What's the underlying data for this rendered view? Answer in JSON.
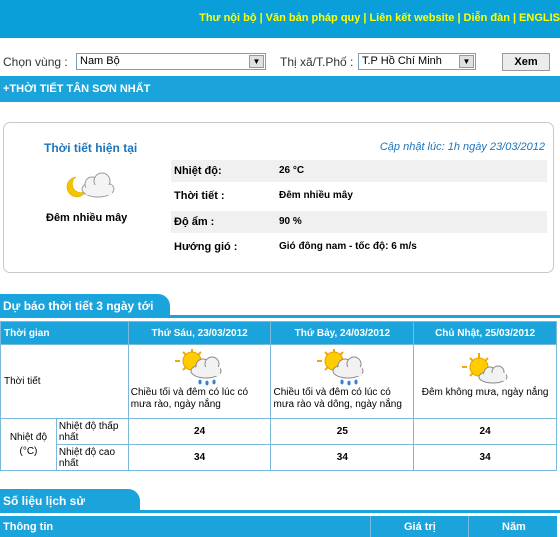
{
  "topnav": {
    "links": [
      "Thư nội bộ",
      "Văn bản pháp quy",
      "Liên kết website",
      "Diễn đàn",
      "ENGLIS"
    ]
  },
  "selector": {
    "region_label": "Chọn vùng :",
    "region_value": "Nam Bộ",
    "city_label": "Thị xã/T.Phố :",
    "city_value": "T.P Hồ Chí Minh",
    "submit_label": "Xem"
  },
  "station_bar": "+THỜI TIẾT  TÂN SƠN NHẤT",
  "current": {
    "title": "Thời tiết hiện tại",
    "updated": "Cập nhật lúc: 1h ngày 23/03/2012",
    "icon": "night-partly-cloudy-icon",
    "description": "Đêm nhiều mây",
    "rows": [
      {
        "key": "Nhiệt độ:",
        "value": "26 °C"
      },
      {
        "key": "Thời tiết :",
        "value": "Đêm nhiều mây"
      },
      {
        "key": "Độ ẩm :",
        "value": "90 %"
      },
      {
        "key": "Hướng gió :",
        "value": "Gió đông nam - tốc độ: 6 m/s"
      }
    ]
  },
  "forecast": {
    "heading": "Dự báo thời tiết 3 ngày tới",
    "time_header": "Thời gian",
    "weather_label": "Thời tiết",
    "temp_label": "Nhiệt độ",
    "temp_unit": "(°C)",
    "low_label": "Nhiệt độ thấp nhất",
    "high_label": "Nhiệt độ cao nhất",
    "days": [
      {
        "date": "Thứ Sáu, 23/03/2012",
        "icon": "sun-cloud-rain-icon",
        "desc": "Chiều tối và đêm có lúc có mưa rào, ngày nắng",
        "low": "24",
        "high": "34"
      },
      {
        "date": "Thứ Bảy, 24/03/2012",
        "icon": "sun-cloud-rain-icon",
        "desc": "Chiều tối và đêm có lúc có mưa rào và dông, ngày nắng",
        "low": "25",
        "high": "34"
      },
      {
        "date": "Chủ Nhật, 25/03/2012",
        "icon": "sun-cloud-icon",
        "desc": "Đêm không mưa, ngày nắng",
        "low": "24",
        "high": "34"
      }
    ]
  },
  "history": {
    "heading": "Số liệu lịch sử",
    "columns": [
      "Thông tin",
      "Giá trị",
      "Năm"
    ]
  },
  "colors": {
    "brand": "#1ba3db",
    "nav_link": "#ffff00",
    "title_blue": "#1e74ba"
  }
}
